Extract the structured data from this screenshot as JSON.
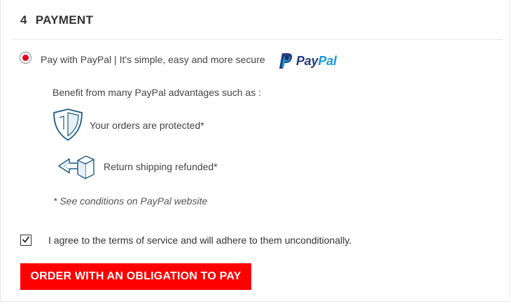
{
  "section": {
    "number": "4",
    "title": "PAYMENT"
  },
  "payment_option": {
    "label": "Pay with PayPal | It's simple, easy and more secure",
    "selected": true,
    "logo": {
      "pay": "Pay",
      "pal": "Pal",
      "icon": "paypal-icon"
    }
  },
  "benefits": {
    "intro": "Benefit from many PayPal advantages such as :",
    "items": [
      {
        "icon": "shield-icon",
        "text": "Your orders are protected*"
      },
      {
        "icon": "return-box-icon",
        "text": "Return shipping refunded*"
      }
    ],
    "conditions": "* See conditions on PayPal website"
  },
  "terms": {
    "checked": true,
    "label": "I agree to the terms of service and will adhere to them unconditionally."
  },
  "order_button": {
    "label": "ORDER WITH AN OBLIGATION TO PAY"
  },
  "colors": {
    "accent_red": "#ff0000",
    "radio_dot": "#e2001a",
    "paypal_dark": "#253b80",
    "paypal_light": "#179bd7",
    "icon_blue": "#1a5a8a"
  }
}
